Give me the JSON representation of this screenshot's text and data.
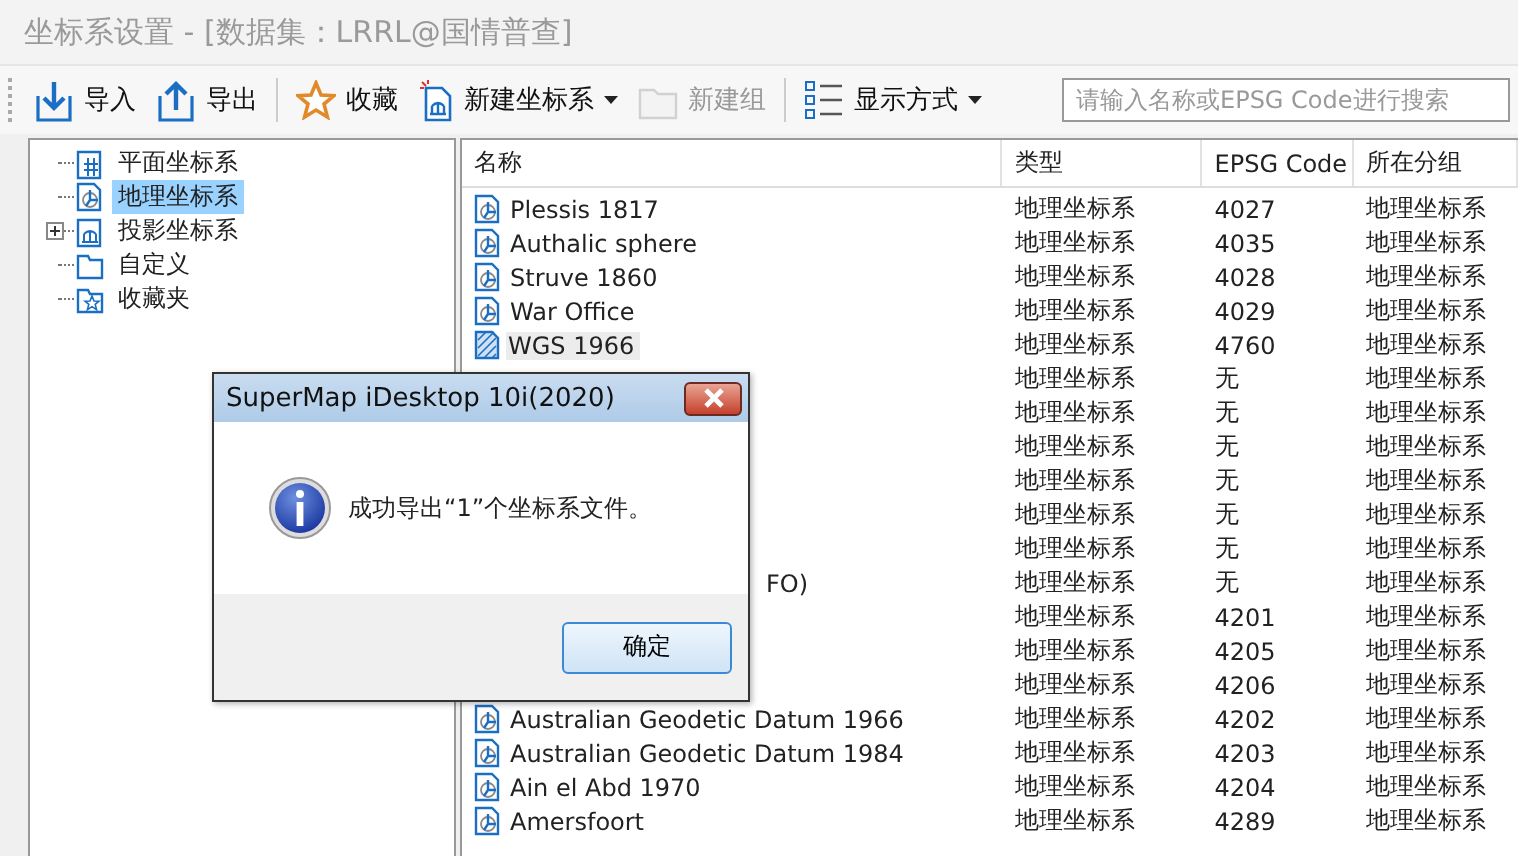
{
  "window": {
    "title": "坐标系设置 - [数据集：LRRL@国情普查]"
  },
  "toolbar": [
    {
      "kind": "button",
      "label": "导入",
      "disabled": false,
      "dropdown": false
    },
    {
      "kind": "button",
      "label": "导出",
      "disabled": false,
      "dropdown": false
    },
    {
      "kind": "separator"
    },
    {
      "kind": "button",
      "label": "收藏",
      "disabled": false,
      "dropdown": false
    },
    {
      "kind": "button",
      "label": "新建坐标系",
      "disabled": false,
      "dropdown": true
    },
    {
      "kind": "button",
      "label": "新建组",
      "disabled": true,
      "dropdown": false
    },
    {
      "kind": "separator"
    },
    {
      "kind": "button",
      "label": "显示方式",
      "disabled": false,
      "dropdown": true
    }
  ],
  "search": {
    "placeholder": "请输入名称或EPSG Code进行搜索"
  },
  "tree": [
    {
      "label": "平面坐标系",
      "selected": false,
      "kind": "leaf"
    },
    {
      "label": "地理坐标系",
      "selected": true,
      "kind": "leaf"
    },
    {
      "label": "投影坐标系",
      "selected": false,
      "kind": "group",
      "expanded": false
    },
    {
      "label": "自定义",
      "selected": false,
      "kind": "leaf"
    },
    {
      "label": "收藏夹",
      "selected": false,
      "kind": "leaf"
    }
  ],
  "table": {
    "columns": [
      "名称",
      "类型",
      "EPSG Code",
      "所在分组"
    ],
    "rows": [
      {
        "name": "Plessis 1817",
        "selected": false,
        "type": "地理坐标系",
        "epsg": "4027",
        "group": "地理坐标系"
      },
      {
        "name": "Authalic sphere",
        "selected": false,
        "type": "地理坐标系",
        "epsg": "4035",
        "group": "地理坐标系"
      },
      {
        "name": "Struve 1860",
        "selected": false,
        "type": "地理坐标系",
        "epsg": "4028",
        "group": "地理坐标系"
      },
      {
        "name": "War Office",
        "selected": false,
        "type": "地理坐标系",
        "epsg": "4029",
        "group": "地理坐标系"
      },
      {
        "name": "WGS 1966",
        "selected": true,
        "type": "地理坐标系",
        "epsg": "4760",
        "group": "地理坐标系"
      },
      {
        "type": "地理坐标系",
        "epsg": "无",
        "group": "地理坐标系"
      },
      {
        "type": "地理坐标系",
        "epsg": "无",
        "group": "地理坐标系"
      },
      {
        "type": "地理坐标系",
        "epsg": "无",
        "group": "地理坐标系"
      },
      {
        "type": "地理坐标系",
        "epsg": "无",
        "group": "地理坐标系"
      },
      {
        "type": "地理坐标系",
        "epsg": "无",
        "group": "地理坐标系"
      },
      {
        "type": "地理坐标系",
        "epsg": "无",
        "group": "地理坐标系"
      },
      {
        "name": "FO)",
        "partial": true,
        "type": "地理坐标系",
        "epsg": "无",
        "group": "地理坐标系"
      },
      {
        "type": "地理坐标系",
        "epsg": "4201",
        "group": "地理坐标系"
      },
      {
        "type": "地理坐标系",
        "epsg": "4205",
        "group": "地理坐标系"
      },
      {
        "type": "地理坐标系",
        "epsg": "4206",
        "group": "地理坐标系"
      },
      {
        "name": "Australian Geodetic Datum 1966",
        "selected": false,
        "type": "地理坐标系",
        "epsg": "4202",
        "group": "地理坐标系"
      },
      {
        "name": "Australian Geodetic Datum 1984",
        "selected": false,
        "type": "地理坐标系",
        "epsg": "4203",
        "group": "地理坐标系"
      },
      {
        "name": "Ain el Abd 1970",
        "selected": false,
        "type": "地理坐标系",
        "epsg": "4204",
        "group": "地理坐标系"
      },
      {
        "name": "Amersfoort",
        "selected": false,
        "type": "地理坐标系",
        "epsg": "4289",
        "group": "地理坐标系"
      }
    ]
  },
  "dialog": {
    "title": "SuperMap iDesktop 10i(2020)",
    "message": "成功导出“1”个坐标系文件。",
    "button": "确定"
  }
}
